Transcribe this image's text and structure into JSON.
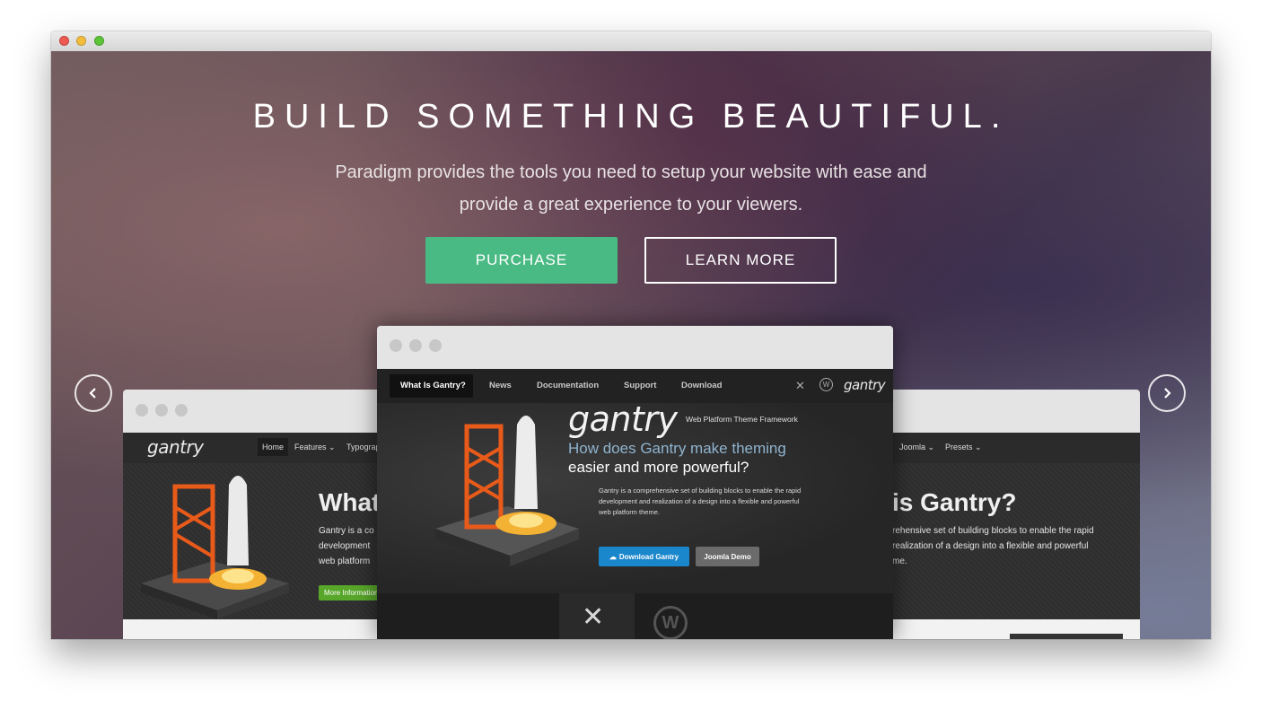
{
  "hero": {
    "headline": "BUILD SOMETHING BEAUTIFUL.",
    "subtext_line1": "Paradigm provides the tools you need to setup your website with ease and",
    "subtext_line2": "provide a great experience to your viewers.",
    "purchase_label": "PURCHASE",
    "learn_more_label": "LEARN MORE",
    "accent_color": "#4aba84"
  },
  "carousel": {
    "prev_icon": "chevron-left-icon",
    "next_icon": "chevron-right-icon"
  },
  "back_screenshot": {
    "logo": "gantry",
    "nav": [
      "Home",
      "Features",
      "Typograp",
      "Joomla",
      "Presets"
    ],
    "heading_left": "What",
    "heading_right": "is Gantry?",
    "body_left_1": "Gantry is a co",
    "body_left_2": "development",
    "body_left_3": "web platform",
    "body_right_1": "rehensive set of building blocks to enable the rapid",
    "body_right_2": "realization of a design into a flexible and powerful",
    "body_right_3": "me.",
    "more_button": "More Information"
  },
  "front_screenshot": {
    "nav": [
      "What Is Gantry?",
      "News",
      "Documentation",
      "Support",
      "Download"
    ],
    "logo": "gantry",
    "logo_subtitle": "Web Platform Theme Framework",
    "tagline_line1": "How does Gantry make theming",
    "tagline_line2": "easier and more powerful?",
    "desc_line1": "Gantry is a comprehensive set of building blocks to enable the rapid",
    "desc_line2": "development and realization of a design into a flexible and powerful",
    "desc_line3": "web platform theme.",
    "download_button": "Download Gantry",
    "joomla_button": "Joomla Demo"
  }
}
